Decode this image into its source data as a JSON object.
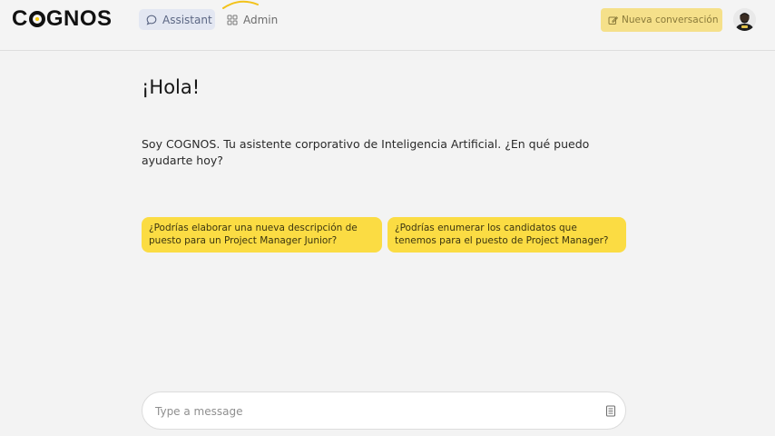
{
  "header": {
    "logo_text": "COGNOS",
    "tabs": [
      {
        "label": "Assistant",
        "icon": "chat-bubble-icon",
        "active": true
      },
      {
        "label": "Admin",
        "icon": "grid-icon",
        "active": false
      }
    ],
    "new_conversation_label": "Nueva conversación",
    "new_conversation_icon": "edit-icon",
    "accent_color": "#fbdc43"
  },
  "main": {
    "greeting": "¡Hola!",
    "intro": "Soy COGNOS. Tu asistente corporativo de Inteligencia Artificial. ¿En qué puedo ayudarte hoy?",
    "suggestions": [
      "¿Podrías elaborar una nueva descripción de puesto para un Project Manager Junior?",
      "¿Podrías enumerar los candidatos que tenemos para el puesto de Project Manager?"
    ]
  },
  "composer": {
    "placeholder": "Type a message",
    "value": "",
    "icon": "document-icon"
  }
}
